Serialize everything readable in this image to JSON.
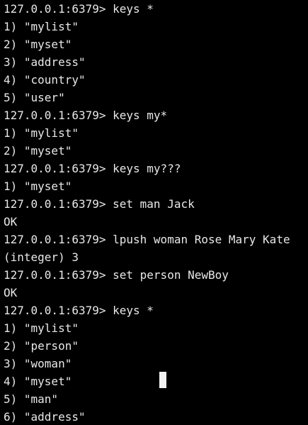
{
  "terminal": {
    "lines": [
      "127.0.0.1:6379> keys *",
      "1) \"mylist\"",
      "2) \"myset\"",
      "3) \"address\"",
      "4) \"country\"",
      "5) \"user\"",
      "127.0.0.1:6379> keys my*",
      "1) \"mylist\"",
      "2) \"myset\"",
      "127.0.0.1:6379> keys my???",
      "1) \"myset\"",
      "127.0.0.1:6379> set man Jack",
      "OK",
      "127.0.0.1:6379> lpush woman Rose Mary Kate",
      "(integer) 3",
      "127.0.0.1:6379> set person NewBoy",
      "OK",
      "127.0.0.1:6379> keys *",
      "1) \"mylist\"",
      "2) \"person\"",
      "3) \"woman\"",
      "4) \"myset\"",
      "5) \"man\"",
      "6) \"address\""
    ],
    "colors": {
      "background": "#000000",
      "text": "#e8e8e8",
      "cursor": "#f2f2f2"
    }
  }
}
